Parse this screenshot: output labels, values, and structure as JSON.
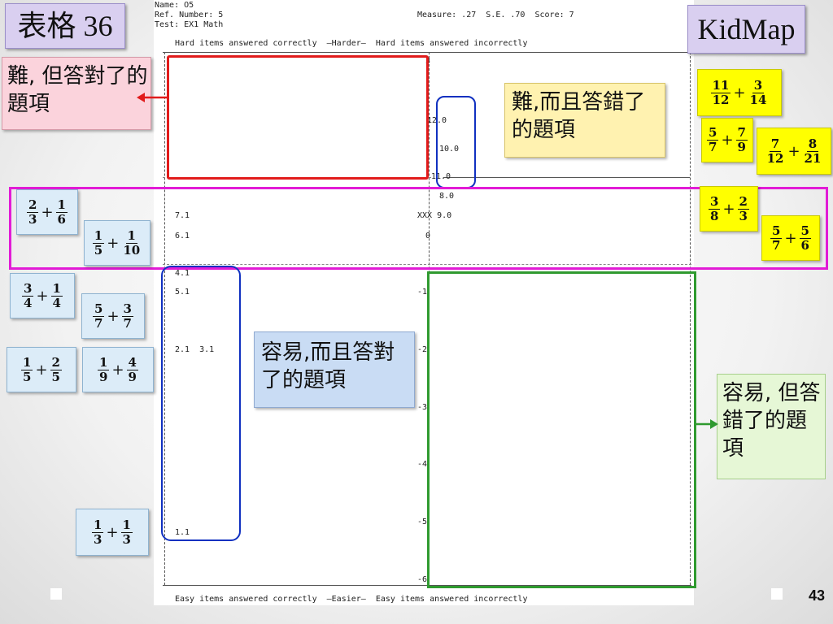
{
  "slide": {
    "title": "表格 36",
    "kidmap_label": "KidMap",
    "slide_number": "43",
    "accent_colors": {
      "red": "#e11b1b",
      "blue": "#1030c0",
      "magenta": "#e21bd6",
      "green": "#2f9a2f",
      "yellow": "#ffff00"
    }
  },
  "header": {
    "name": "Name: O5",
    "ref": "Ref. Number: 5",
    "test": "Test: EX1 Math",
    "measure": "Measure: .27  S.E. .70  Score: 7",
    "top_row": "Hard items answered correctly  —Harder—  Hard items answered incorrectly",
    "bottom_row": "Easy items answered correctly  —Easier—  Easy items answered incorrectly"
  },
  "map": {
    "scale_3": "3",
    "item_12": "12.0",
    "item_10": "10.0",
    "item_11": "11.0",
    "item_8": "8.0",
    "person_row": "XXX 9.0",
    "scale_0": "0",
    "left_71": "7.1",
    "left_61": "6.1",
    "left_41": "4.1",
    "left_51": "5.1",
    "left_21_31": "2.1  3.1",
    "left_11": "1.1",
    "tick_m2": "-2",
    "tick_m3": "-3",
    "tick_m4": "-4",
    "tick_m5": "-5",
    "tick_m1": "-1",
    "tick_m6": "-6"
  },
  "callouts": {
    "hard_correct": "難, 但答對了的題項",
    "hard_incorrect": "難,而且答錯了的題項",
    "easy_correct": "容易,而且答對了的題項",
    "easy_incorrect": "容易, 但答錯了的題項"
  },
  "fractions": {
    "y1": {
      "a_n": "11",
      "a_d": "12",
      "op": "+",
      "b_n": "3",
      "b_d": "14"
    },
    "y2": {
      "a_n": "5",
      "a_d": "7",
      "op": "+",
      "b_n": "7",
      "b_d": "9"
    },
    "y3": {
      "a_n": "7",
      "a_d": "12",
      "op": "+",
      "b_n": "8",
      "b_d": "21"
    },
    "y4": {
      "a_n": "3",
      "a_d": "8",
      "op": "+",
      "b_n": "2",
      "b_d": "3"
    },
    "y5": {
      "a_n": "5",
      "a_d": "7",
      "op": "+",
      "b_n": "5",
      "b_d": "6"
    },
    "b1": {
      "a_n": "2",
      "a_d": "3",
      "op": "+",
      "b_n": "1",
      "b_d": "6"
    },
    "b2": {
      "a_n": "1",
      "a_d": "5",
      "op": "+",
      "b_n": "1",
      "b_d": "10"
    },
    "b3": {
      "a_n": "3",
      "a_d": "4",
      "op": "+",
      "b_n": "1",
      "b_d": "4"
    },
    "b4": {
      "a_n": "5",
      "a_d": "7",
      "op": "+",
      "b_n": "3",
      "b_d": "7"
    },
    "b5": {
      "a_n": "1",
      "a_d": "5",
      "op": "+",
      "b_n": "2",
      "b_d": "5"
    },
    "b6": {
      "a_n": "1",
      "a_d": "9",
      "op": "+",
      "b_n": "4",
      "b_d": "9"
    },
    "b7": {
      "a_n": "1",
      "a_d": "3",
      "op": "+",
      "b_n": "1",
      "b_d": "3"
    }
  }
}
